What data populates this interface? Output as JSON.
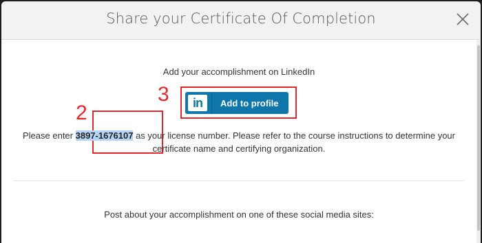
{
  "modal": {
    "title": "Share your Certificate Of Completion",
    "close_icon": "close-icon"
  },
  "linkedin": {
    "intro": "Add your accomplishment on LinkedIn",
    "logo_text": "in",
    "button_label": "Add to profile",
    "brand_color": "#0e76a8"
  },
  "license": {
    "prefix": "Please enter ",
    "number": "3897-1676107",
    "suffix": " as your license number. Please refer to the course instructions to determine your certificate name and certifying organization."
  },
  "social": {
    "intro": "Post about your accomplishment on one of these social media sites:"
  },
  "annotations": {
    "color": "#e5262b",
    "license_step": "2",
    "linkedin_step": "3"
  }
}
